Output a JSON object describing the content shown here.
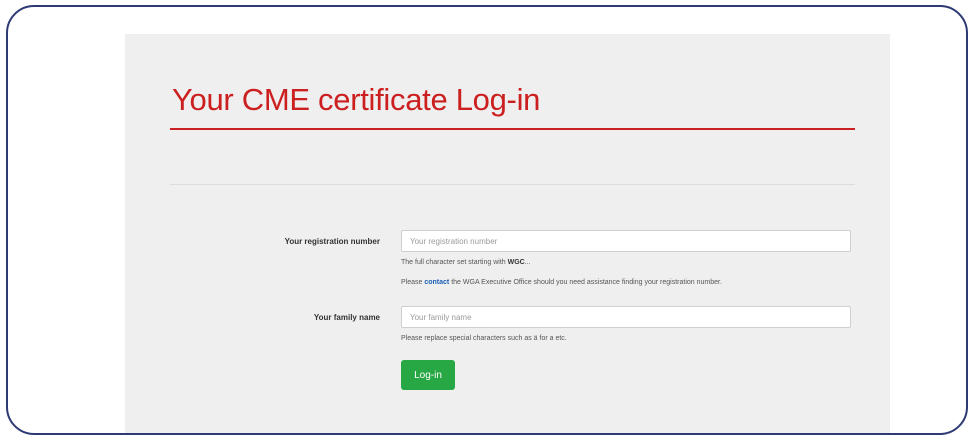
{
  "login": {
    "title": "Your CME certificate Log-in",
    "registration": {
      "label": "Your registration number",
      "placeholder": "Your registration number",
      "value": "",
      "help_prefix": "The full character set starting with ",
      "help_strong": "WGC",
      "help_suffix": "...",
      "assist_prefix": "Please ",
      "assist_link": "contact",
      "assist_suffix": " the WGA Executive Office should you need assistance finding your registration number."
    },
    "family_name": {
      "label": "Your family name",
      "placeholder": "Your family name",
      "value": "",
      "help": "Please replace special characters such as ä for a etc."
    },
    "submit_label": "Log-in"
  },
  "colors": {
    "title_red": "#cc1f1f",
    "button_green": "#28a745",
    "frame_navy": "#2e3a73",
    "link_blue": "#1a5fb4"
  }
}
